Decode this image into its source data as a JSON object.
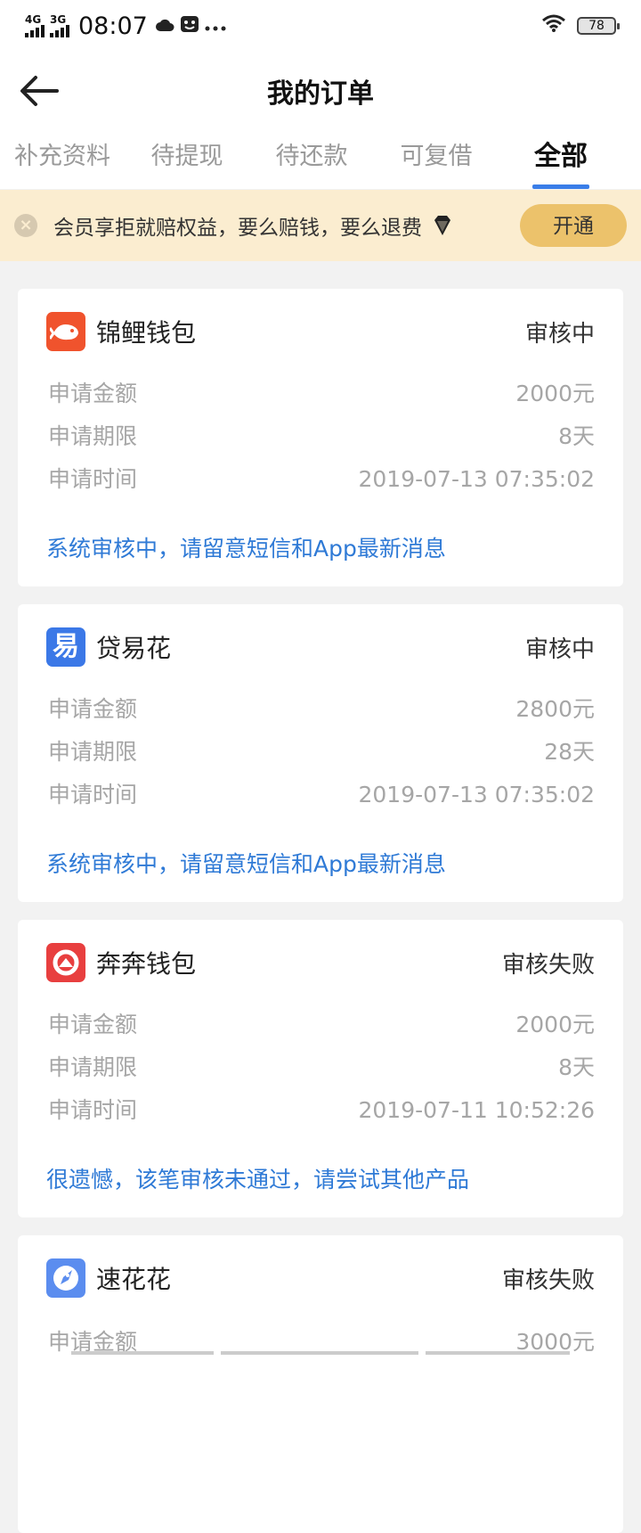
{
  "status_bar": {
    "net1": "4G",
    "net2": "3G",
    "time": "08:07",
    "battery": "78",
    "icons": [
      "cloud-icon",
      "app-notification-icon",
      "more-icon",
      "wifi-icon",
      "battery-icon"
    ]
  },
  "header": {
    "title": "我的订单"
  },
  "tabs": [
    {
      "label": "补充资料"
    },
    {
      "label": "待提现"
    },
    {
      "label": "待还款"
    },
    {
      "label": "可复借"
    },
    {
      "label": "全部"
    }
  ],
  "active_tab": "全部",
  "banner": {
    "text": "会员享拒就赔权益，要么赔钱，要么退费",
    "button": "开通"
  },
  "labels": {
    "amount": "申请金额",
    "term": "申请期限",
    "time": "申请时间"
  },
  "orders": [
    {
      "name": "锦鲤钱包",
      "status": "审核中",
      "amount": "2000元",
      "term": "8天",
      "time": "2019-07-13 07:35:02",
      "message": "系统审核中，请留意短信和App最新消息",
      "logo_color": "#f0532d"
    },
    {
      "name": "贷易花",
      "status": "审核中",
      "amount": "2800元",
      "term": "28天",
      "time": "2019-07-13 07:35:02",
      "message": "系统审核中，请留意短信和App最新消息",
      "logo_color": "#3b78e7",
      "logo_text": "易"
    },
    {
      "name": "奔奔钱包",
      "status": "审核失败",
      "amount": "2000元",
      "term": "8天",
      "time": "2019-07-11 10:52:26",
      "message": "很遗憾，该笔审核未通过，请尝试其他产品",
      "logo_color": "#e83f3f"
    },
    {
      "name": "速花花",
      "status": "审核失败",
      "amount": "3000元",
      "logo_color": "#5b8def"
    }
  ],
  "colors": {
    "accent_blue": "#2f7ad6",
    "tab_indicator": "#3a7ee8",
    "banner_bg": "#fbedd0",
    "banner_button": "#ecc26b"
  }
}
